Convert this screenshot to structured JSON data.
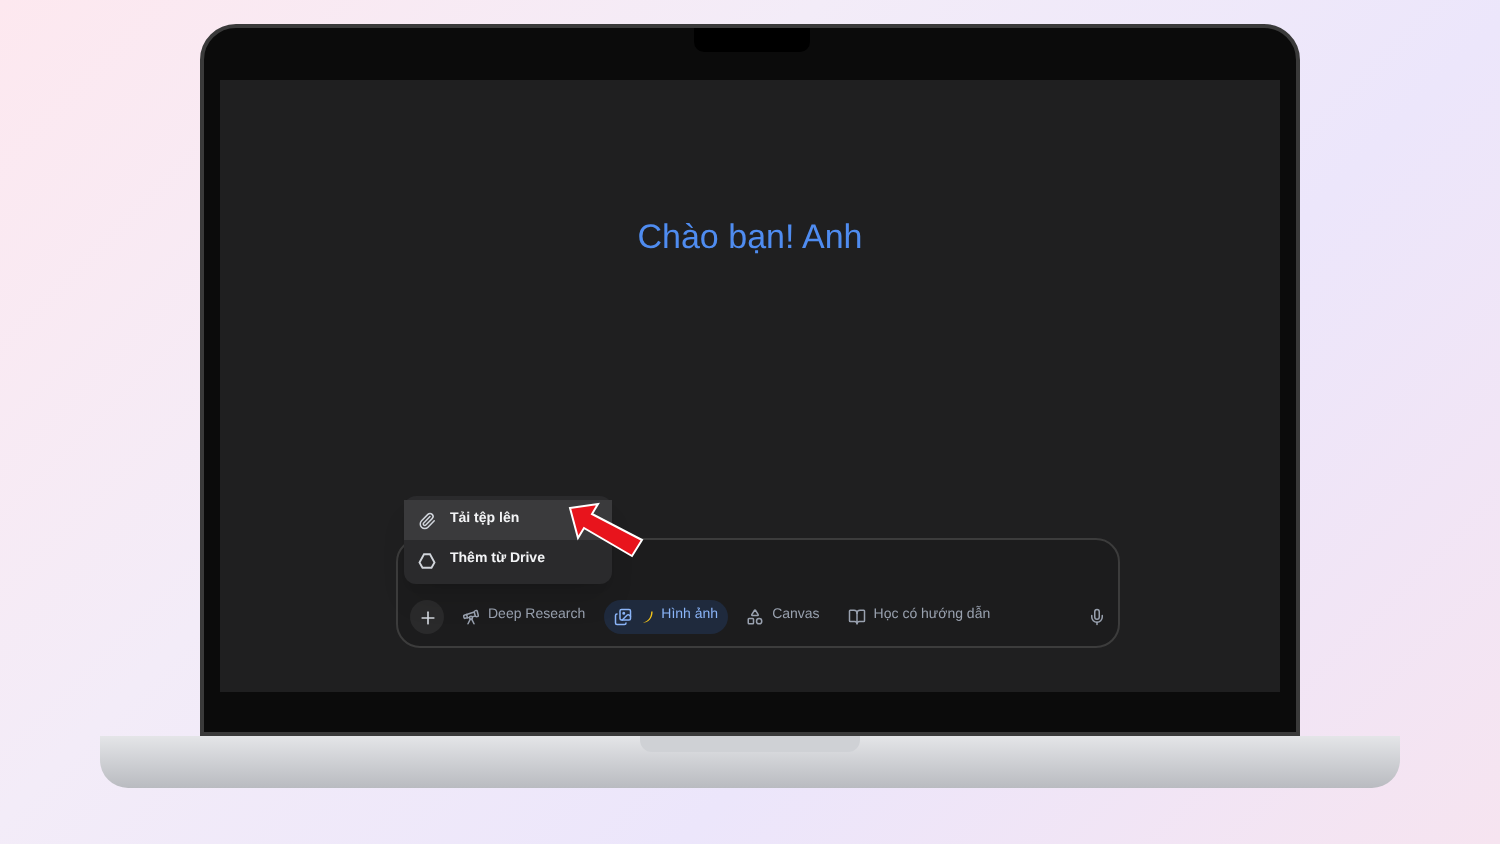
{
  "greeting": "Chào bạn! Anh",
  "upload_menu": [
    {
      "label": "Tải tệp lên",
      "kind": "file",
      "selected": true
    },
    {
      "label": "Thêm từ Drive",
      "kind": "drive",
      "selected": false
    }
  ],
  "toolbar": {
    "tools": [
      {
        "label": "Deep Research",
        "kind": "research",
        "selected": false
      },
      {
        "label": "Hình ảnh",
        "kind": "image",
        "selected": true
      },
      {
        "label": "Canvas",
        "kind": "canvas",
        "selected": false
      },
      {
        "label": "Học có hướng dẫn",
        "kind": "learn",
        "selected": false
      }
    ]
  }
}
